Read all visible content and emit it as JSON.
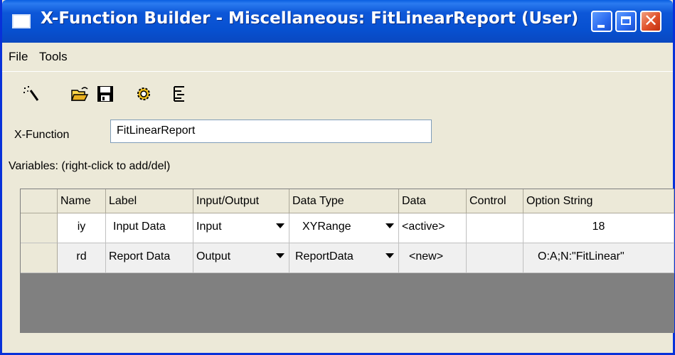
{
  "window": {
    "title": "X-Function Builder - Miscellaneous: FitLinearReport (User)",
    "close_glyph": "✕"
  },
  "menu": {
    "file": "File",
    "tools": "Tools"
  },
  "toolbar": {
    "icons": [
      "wizard-wand-icon",
      "open-folder-icon",
      "save-icon",
      "gear-icon",
      "tree-view-icon"
    ]
  },
  "form": {
    "xfunction_label": "X-Function",
    "xfunction_value": "FitLinearReport",
    "variables_label": "Variables: (right-click to add/del)"
  },
  "grid": {
    "columns": [
      "Name",
      "Label",
      "Input/Output",
      "Data Type",
      "Data",
      "Control",
      "Option String"
    ],
    "rows": [
      {
        "name": "iy",
        "label": "Input Data",
        "io": "Input",
        "data_type": "XYRange",
        "data": "<active>",
        "control": "",
        "option": "18"
      },
      {
        "name": "rd",
        "label": "Report Data",
        "io": "Output",
        "data_type": "ReportData",
        "data": "<new>",
        "control": "",
        "option": "O:A;N:\"FitLinear\""
      }
    ]
  },
  "colors": {
    "title_bar": "#0a56d8",
    "window_bg": "#ece9d8",
    "grid_empty": "#808080"
  }
}
